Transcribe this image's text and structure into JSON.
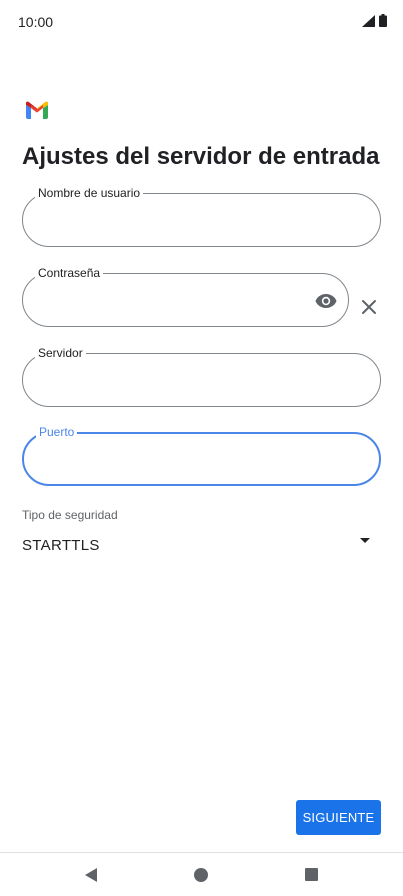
{
  "status_bar": {
    "time": "10:00"
  },
  "app": {
    "logo_icon": "gmail-m-icon"
  },
  "page": {
    "title": "Ajustes del servidor de entrada"
  },
  "fields": {
    "username": {
      "label": "Nombre de usuario",
      "value": ""
    },
    "password": {
      "label": "Contraseña",
      "value": ""
    },
    "server": {
      "label": "Servidor",
      "value": ""
    },
    "port": {
      "label": "Puerto",
      "value": ""
    }
  },
  "security": {
    "label": "Tipo de seguridad",
    "selected": "STARTTLS"
  },
  "actions": {
    "next_label": "SIGUIENTE"
  },
  "colors": {
    "accent": "#1a73e8",
    "focus": "#4a86e8",
    "outline": "#80868b"
  }
}
